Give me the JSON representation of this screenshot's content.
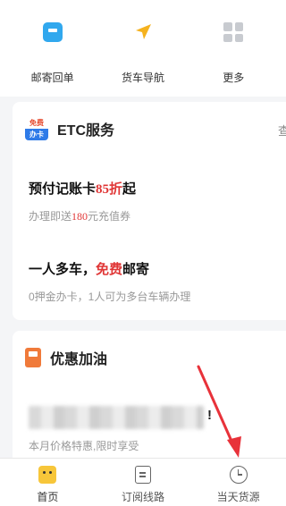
{
  "quick_actions": [
    {
      "label": "邮寄回单",
      "icon": "mail-receipt-icon"
    },
    {
      "label": "货车导航",
      "icon": "navigation-arrow-icon"
    },
    {
      "label": "更多",
      "icon": "more-grid-icon"
    }
  ],
  "etc_card": {
    "badge_top": "免费",
    "badge_bottom": "办卡",
    "title": "ETC服务",
    "more": "查",
    "promo1": {
      "title_pre": "预付记账卡",
      "title_hl": "85折",
      "title_post": "起",
      "sub_pre": "办理即送",
      "sub_hl": "180",
      "sub_post": "元充值券"
    },
    "promo2": {
      "title_pre": "一人多车，",
      "title_hl": "免费",
      "title_post": "邮寄",
      "sub": "0押金办卡，1人可为多台车辆办理"
    }
  },
  "fuel_card": {
    "title": "优惠加油",
    "blur_mark": "!",
    "sub": "本月价格特惠,限时享受"
  },
  "bottom_nav": [
    {
      "label": "首页",
      "icon": "home-icon"
    },
    {
      "label": "订阅线路",
      "icon": "subscription-doc-icon"
    },
    {
      "label": "当天货源",
      "icon": "clock-icon"
    }
  ],
  "colors": {
    "accent_red": "#e03636",
    "arrow_red": "#e8323a",
    "brand_yellow": "#f7c63a"
  }
}
